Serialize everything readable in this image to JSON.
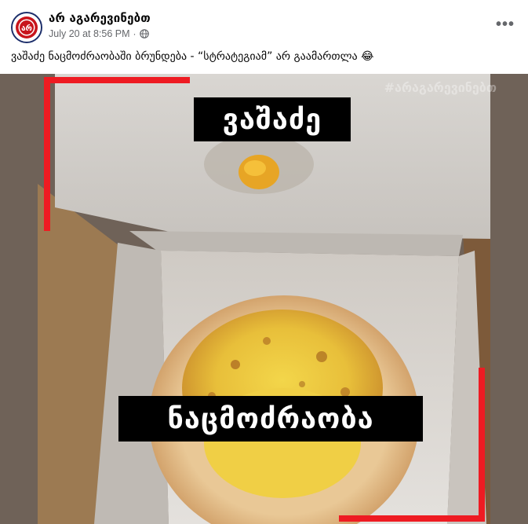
{
  "post": {
    "page_name": "არ აგარევინებთ",
    "timestamp": "July 20 at 8:56 PM",
    "separator": "·",
    "privacy_icon": "globe-icon",
    "more_icon": "more-options-icon",
    "more_label": "•••",
    "caption": "ვაშაძე ნაცმოძრაობაში ბრუნდება - “სტრატეგიამ” არ გაამართლა 😂",
    "avatar_text": "არ"
  },
  "image": {
    "watermark": "#არაგარევინებთ",
    "top_label": "ვაშაძე",
    "bottom_label": "ნაცმოძრაობა",
    "accent_color": "#ee1b22",
    "label_bg": "#000000"
  }
}
